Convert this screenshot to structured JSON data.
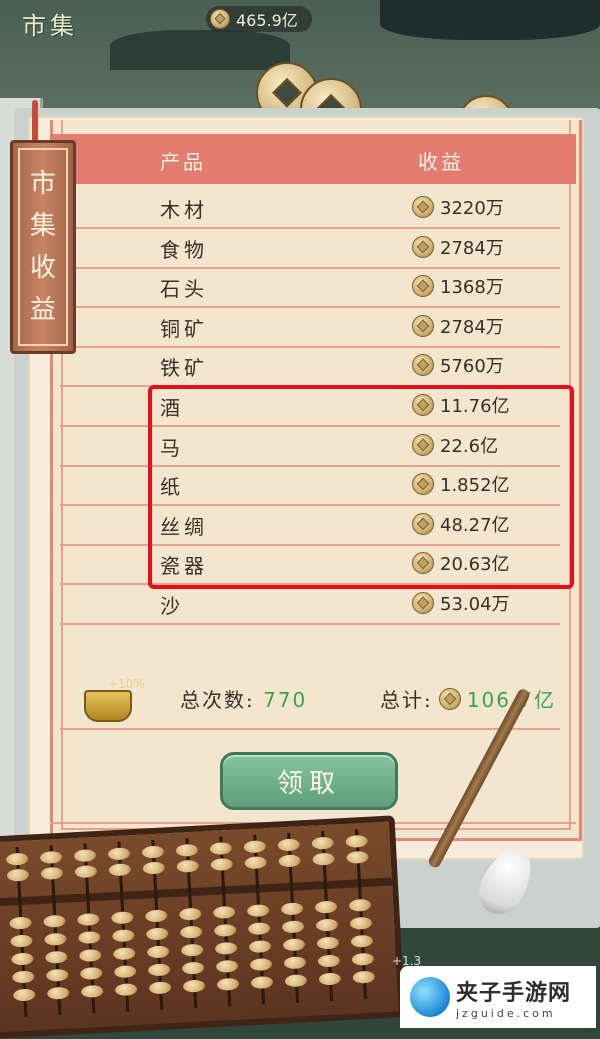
{
  "top_bar": {
    "title": "市集",
    "currency_value": "465.9亿"
  },
  "bookmark": {
    "text": "市集收益"
  },
  "table": {
    "col_product": "产品",
    "col_income": "收益",
    "rows": [
      {
        "name": "木材",
        "value": "3220万"
      },
      {
        "name": "食物",
        "value": "2784万"
      },
      {
        "name": "石头",
        "value": "1368万"
      },
      {
        "name": "铜矿",
        "value": "2784万"
      },
      {
        "name": "铁矿",
        "value": "5760万"
      },
      {
        "name": "酒",
        "value": "11.76亿"
      },
      {
        "name": "马",
        "value": "22.6亿"
      },
      {
        "name": "纸",
        "value": "1.852亿"
      },
      {
        "name": "丝绸",
        "value": "48.27亿"
      },
      {
        "name": "瓷器",
        "value": "20.63亿"
      },
      {
        "name": "沙",
        "value": "53.04万"
      }
    ]
  },
  "summary": {
    "bonus": "+10%",
    "count_label": "总次数:",
    "count_value": "770",
    "total_label": "总计:",
    "total_value": "106.7亿"
  },
  "claim_button": "领取",
  "side_badge": "+1.3",
  "watermark": {
    "name": "夹子手游网",
    "domain": "jzguide.com"
  },
  "colors": {
    "header_band": "#e27d70",
    "highlight_box": "#e6101d",
    "summary_green": "#3fa24e",
    "button_green": "#6fae8b"
  }
}
